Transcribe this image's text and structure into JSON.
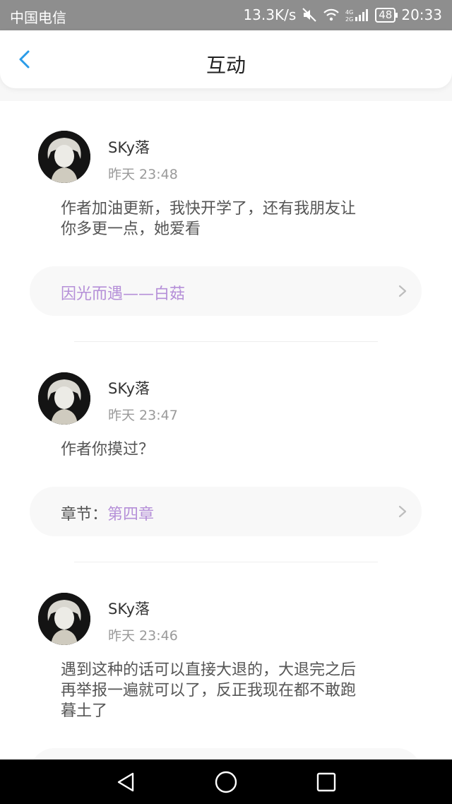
{
  "status_bar": {
    "carrier": "中国电信",
    "net_speed": "13.3K/s",
    "network_label": "4G 2G",
    "battery": "48",
    "time": "20:33"
  },
  "header": {
    "title": "互动"
  },
  "items": [
    {
      "username": "SKy落",
      "time": "昨天 23:48",
      "comment_lines": [
        "作者加油更新，我快开学了，还有我朋友让",
        "你多更一点，她爱看"
      ],
      "link_prefix": "",
      "link_text": "因光而遇——白菇"
    },
    {
      "username": "SKy落",
      "time": "昨天 23:47",
      "comment_lines": [
        "作者你摸过？"
      ],
      "link_prefix": "章节：",
      "link_text": "第四章"
    },
    {
      "username": "SKy落",
      "time": "昨天 23:46",
      "comment_lines": [
        "遇到这种的话可以直接大退的，大退完之后",
        "再举报一遍就可以了，反正我现在都不敢跑",
        "暮土了"
      ],
      "link_prefix": "",
      "link_text": ""
    }
  ],
  "colors": {
    "accent": "#2a9be8",
    "link": "#b58fd8",
    "status_bar": "#8e8e8e"
  },
  "icons": {
    "back": "chevron-left-icon",
    "chevron": "chevron-right-icon",
    "nav": [
      "back-triangle-icon",
      "home-circle-icon",
      "recents-square-icon"
    ]
  }
}
